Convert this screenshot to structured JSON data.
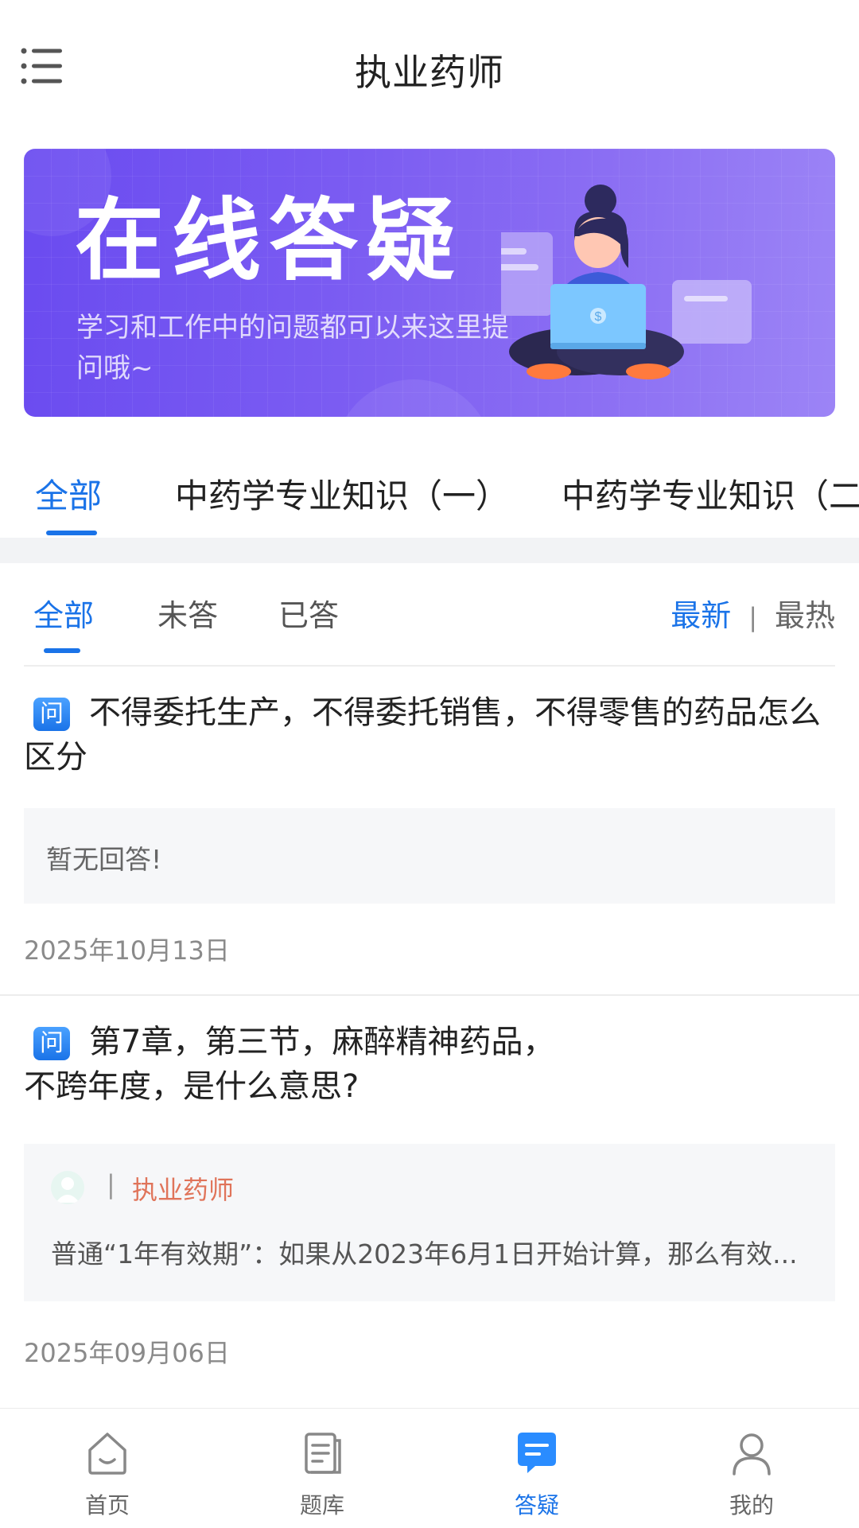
{
  "header": {
    "title": "执业药师"
  },
  "banner": {
    "title": "在线答疑",
    "subtitle": "学习和工作中的问题都可以来这里提问哦~"
  },
  "category_tabs": [
    {
      "label": "全部",
      "active": true
    },
    {
      "label": "中药学专业知识（一）",
      "active": false
    },
    {
      "label": "中药学专业知识（二",
      "active": false
    }
  ],
  "filter": {
    "tabs": [
      {
        "label": "全部",
        "active": true
      },
      {
        "label": "未答",
        "active": false
      },
      {
        "label": "已答",
        "active": false
      }
    ],
    "sort": {
      "newest": "最新",
      "separator": "|",
      "hottest": "最热"
    }
  },
  "questions": [
    {
      "badge": "问",
      "text": "不得委托生产，不得委托销售，不得零售的药品怎么区分",
      "answer_placeholder": "暂无回答!",
      "date": "2025年10月13日"
    },
    {
      "badge": "问",
      "text_line1": "第7章，第三节，麻醉精神药品，",
      "text_line2": "不跨年度，是什么意思?",
      "answer": {
        "separator": "|",
        "author": "执业药师",
        "text": "普通“1年有效期”：如果从2023年6月1日开始计算，那么有效..."
      },
      "date": "2025年09月06日"
    }
  ],
  "bottom_nav": [
    {
      "label": "首页",
      "icon": "home-icon",
      "active": false
    },
    {
      "label": "题库",
      "icon": "question-bank-icon",
      "active": false
    },
    {
      "label": "答疑",
      "icon": "qa-chat-icon",
      "active": true
    },
    {
      "label": "我的",
      "icon": "profile-icon",
      "active": false
    }
  ],
  "colors": {
    "accent": "#1a73e8",
    "author": "#e0745a",
    "banner_start": "#6a4bf0",
    "banner_end": "#9c84f6"
  }
}
